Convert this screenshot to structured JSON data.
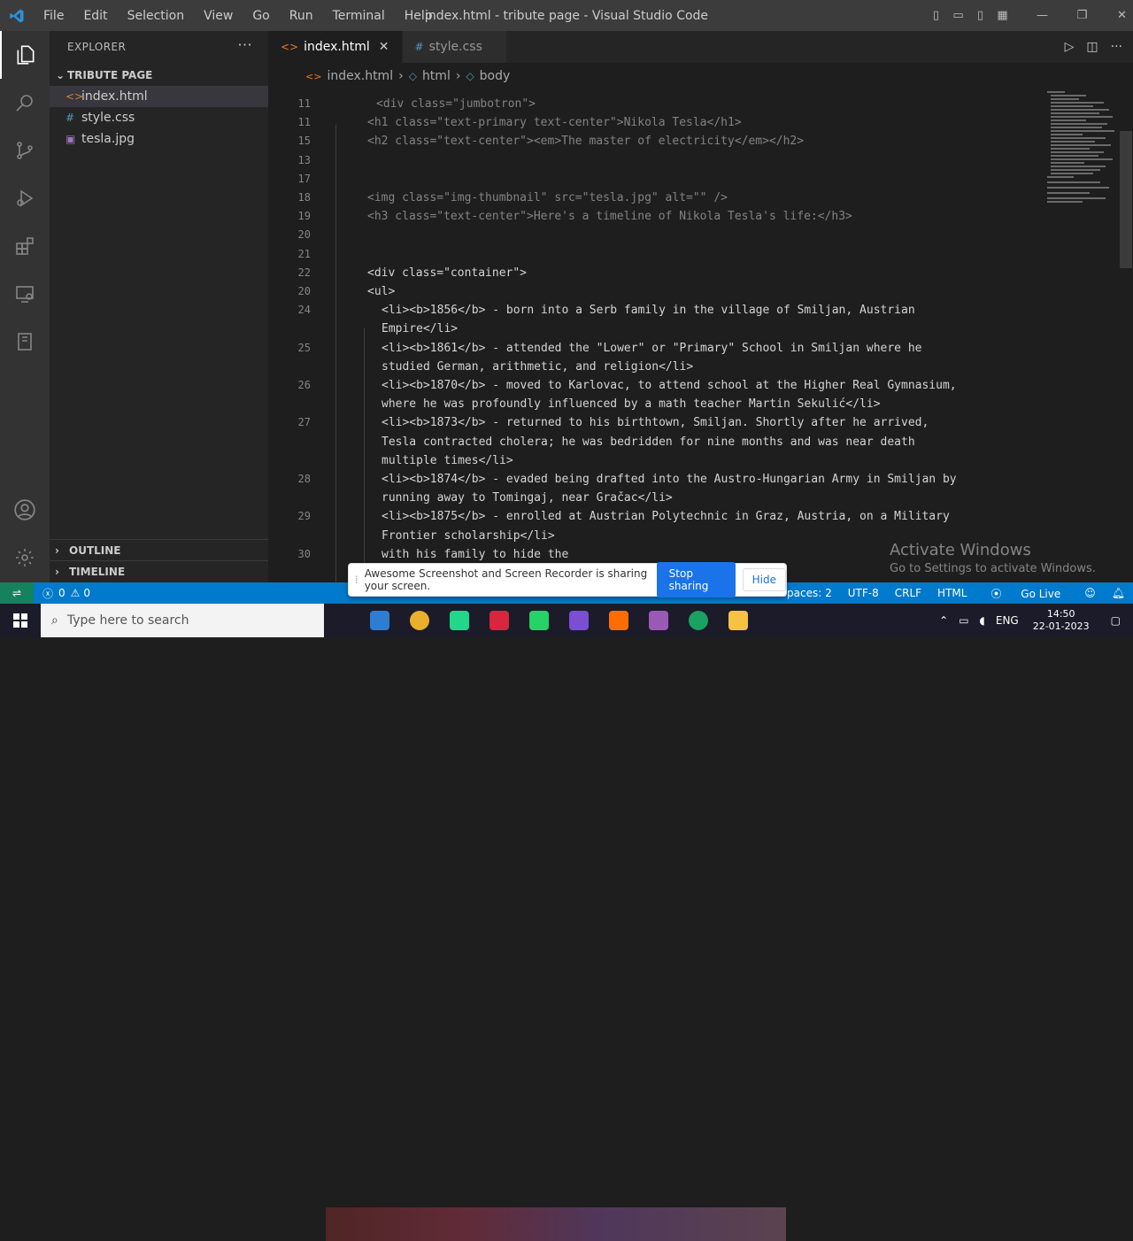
{
  "titlebar": {
    "menu": [
      "File",
      "Edit",
      "Selection",
      "View",
      "Go",
      "Run",
      "Terminal",
      "Help"
    ],
    "title": "index.html - tribute page - Visual Studio Code"
  },
  "sidebar": {
    "header": "EXPLORER",
    "folder": "TRIBUTE PAGE",
    "files": [
      {
        "name": "index.html",
        "icon": "<>",
        "icon_color": "#e37933"
      },
      {
        "name": "style.css",
        "icon": "#",
        "icon_color": "#519aba"
      },
      {
        "name": "tesla.jpg",
        "icon": "▣",
        "icon_color": "#a074c4"
      }
    ],
    "outline": "OUTLINE",
    "timeline": "TIMELINE"
  },
  "tabs": [
    {
      "label": "index.html",
      "icon": "<>",
      "icon_color": "#e37933"
    },
    {
      "label": "style.css",
      "icon": "#",
      "icon_color": "#519aba"
    }
  ],
  "breadcrumb": [
    "index.html",
    "html",
    "body"
  ],
  "editor": {
    "lines": [
      {
        "n": "11",
        "code": "<div class=\"jumbotron\">"
      },
      {
        "n": "11",
        "code": "<h1 class=\"text-primary text-center\">Nikola Tesla</h1>"
      },
      {
        "n": "15",
        "code": "<h2 class=\"text-center\"><em>The master of electricity</em></h2>"
      },
      {
        "n": "13",
        "code": ""
      },
      {
        "n": "17",
        "code": ""
      },
      {
        "n": "18",
        "code": "<img class=\"img-thumbnail\" src=\"tesla.jpg\" alt=\"\" />"
      },
      {
        "n": "19",
        "code": "<h3 class=\"text-center\">Here's a timeline of Nikola Tesla's life:</h3>"
      },
      {
        "n": "20",
        "code": ""
      },
      {
        "n": "21",
        "code": ""
      },
      {
        "n": "22",
        "code": "<div class=\"container\">"
      },
      {
        "n": "20",
        "code": "<ul>"
      },
      {
        "n": "24",
        "code": "<li><b>1856</b> - born into a Serb family in the village of Smiljan, Austrian"
      },
      {
        "n": "",
        "code": "Empire</li>"
      },
      {
        "n": "25",
        "code": "<li><b>1861</b> - attended the \"Lower\" or \"Primary\" School in Smiljan where he"
      },
      {
        "n": "",
        "code": "studied German, arithmetic, and religion</li>"
      },
      {
        "n": "26",
        "code": "<li><b>1870</b> - moved to Karlovac, to attend school at the Higher Real Gymnasium,"
      },
      {
        "n": "",
        "code": "where he was profoundly influenced by a math teacher Martin Sekulić</li>"
      },
      {
        "n": "27",
        "code": "<li><b>1873</b> - returned to his birthtown, Smiljan. Shortly after he arrived,"
      },
      {
        "n": "",
        "code": "Tesla contracted cholera; he was bedridden for nine months and was near death"
      },
      {
        "n": "",
        "code": "multiple times</li>"
      },
      {
        "n": "28",
        "code": "<li><b>1874</b> - evaded being drafted into the Austro-Hungarian Army in Smiljan by"
      },
      {
        "n": "",
        "code": "running away to Tomingaj, near Gračac</li>"
      },
      {
        "n": "29",
        "code": "<li><b>1875</b> - enrolled at Austrian Polytechnic in Graz, Austria, on a Military"
      },
      {
        "n": "",
        "code": "Frontier scholarship</li>"
      },
      {
        "n": "30",
        "code": "with his family to hide the"
      }
    ]
  },
  "statusbar": {
    "errors": "0",
    "warnings": "0",
    "right": [
      "Spaces: 2",
      "UTF-8",
      "CRLF",
      "HTML",
      "Go Live"
    ]
  },
  "share_banner": {
    "message": "Awesome Screenshot and Screen Recorder is sharing your screen.",
    "stop": "Stop sharing",
    "hide": "Hide"
  },
  "watermark": {
    "title": "Activate Windows",
    "subtitle": "Go to Settings to activate Windows."
  },
  "taskbar": {
    "search_placeholder": "Type here to search",
    "lang": "ENG",
    "time": "14:50",
    "date": "22-01-2023",
    "apps": [
      {
        "name": "vscode",
        "color": "#2f7dd1"
      },
      {
        "name": "chrome",
        "color": "#e8b02b"
      },
      {
        "name": "pycharm",
        "color": "#21d789"
      },
      {
        "name": "app-red",
        "color": "#d7263d"
      },
      {
        "name": "whatsapp",
        "color": "#25d366"
      },
      {
        "name": "app-purple",
        "color": "#7a4fd1"
      },
      {
        "name": "app-orange",
        "color": "#ff6d00"
      },
      {
        "name": "app-violet",
        "color": "#9b59b6"
      },
      {
        "name": "chrome-2",
        "color": "#1aa260"
      },
      {
        "name": "folder",
        "color": "#f5c242"
      }
    ]
  }
}
